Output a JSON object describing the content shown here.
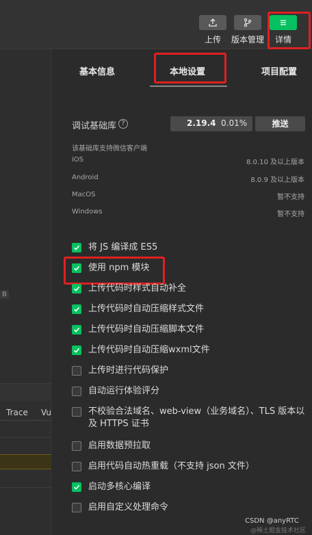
{
  "toolbar": {
    "upload_label": "上传",
    "version_label": "版本管理",
    "details_label": "详情",
    "accent_color": "#07c160"
  },
  "left_panel": {
    "badge": "B",
    "columns": [
      "Trace",
      "Vu"
    ]
  },
  "tabs": {
    "basic": "基本信息",
    "local": "本地设置",
    "project": "项目配置",
    "active": "本地设置"
  },
  "base_library": {
    "label": "调试基础库",
    "help_icon": "?",
    "version": "2.19.4",
    "coverage": "0.01%",
    "push_label": "推送",
    "support_note": "该基础库支持微信客户端",
    "platforms": [
      {
        "name": "iOS",
        "value": "8.0.10 及以上版本"
      },
      {
        "name": "Android",
        "value": "8.0.9 及以上版本"
      },
      {
        "name": "MacOS",
        "value": "暂不支持"
      },
      {
        "name": "Windows",
        "value": "暂不支持"
      }
    ]
  },
  "options": [
    {
      "label": "将 JS 编译成 ES5",
      "checked": true
    },
    {
      "label": "使用 npm 模块",
      "checked": true
    },
    {
      "label": "上传代码时样式自动补全",
      "checked": true
    },
    {
      "label": "上传代码时自动压缩样式文件",
      "checked": true
    },
    {
      "label": "上传代码时自动压缩脚本文件",
      "checked": true
    },
    {
      "label": "上传代码时自动压缩wxml文件",
      "checked": true
    },
    {
      "label": "上传时进行代码保护",
      "checked": false
    },
    {
      "label": "自动运行体验评分",
      "checked": false
    },
    {
      "label": "不校验合法域名、web-view（业务域名）、TLS 版本以及 HTTPS 证书",
      "checked": false
    },
    {
      "label": "启用数据预拉取",
      "checked": false
    },
    {
      "label": "启用代码自动热重载（不支持 json 文件）",
      "checked": false
    },
    {
      "label": "启动多核心编译",
      "checked": true
    },
    {
      "label": "启用自定义处理命令",
      "checked": false
    }
  ],
  "watermark": "CSDN @anyRTC",
  "watermark_sub": "@稀土掘金技术社区"
}
